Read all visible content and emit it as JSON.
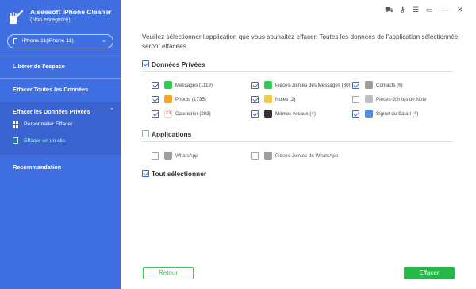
{
  "app": {
    "title": "Aiseesoft iPhone Cleaner",
    "subtitle": "(Non enregistré)"
  },
  "device": {
    "name": "iPhone 11(iPhone 11)"
  },
  "sidebar": {
    "items": [
      {
        "label": "Libérer de l'espace"
      },
      {
        "label": "Effacer Toutes les Données"
      },
      {
        "label": "Effacer les Données Privées"
      },
      {
        "label": "Recommandation"
      }
    ],
    "sub_items": [
      {
        "label": "Personnalier Effacer"
      },
      {
        "label": "Effacer en un clic"
      }
    ]
  },
  "topbar": {
    "icons": [
      "cart-icon",
      "key-icon",
      "menu-icon",
      "feedback-icon",
      "minimize-icon",
      "close-icon"
    ]
  },
  "main": {
    "intro": "Veuillez sélectionner l'application que vous souhaitez effacer. Toutes les données de l'application sélectionnée seront effacées.",
    "private_section": {
      "title": "Données Privées",
      "items": [
        {
          "label": "Messages (1119)",
          "icon": "messages-icon",
          "color": "#34c759",
          "checked": true
        },
        {
          "label": "Pièces-Jointes des Messages (30)",
          "icon": "message-attachments-icon",
          "color": "#34c759",
          "checked": true
        },
        {
          "label": "Contacts (6)",
          "icon": "contacts-icon",
          "color": "#9c9c9c",
          "checked": true
        },
        {
          "label": "Photos (1735)",
          "icon": "photos-icon",
          "color": "#f5a623",
          "checked": true
        },
        {
          "label": "Notes (2)",
          "icon": "notes-icon",
          "color": "#f7c948",
          "checked": true
        },
        {
          "label": "Pièces-Jointes de Note",
          "icon": "note-attachments-icon",
          "color": "#bdbdbd",
          "checked": false
        },
        {
          "label": "Calendrier (203)",
          "icon": "calendar-icon",
          "color": "#e94b3c",
          "checked": true,
          "glyph": "23"
        },
        {
          "label": "Mémos vocaux (4)",
          "icon": "voice-memos-icon",
          "color": "#333333",
          "checked": true
        },
        {
          "label": "Signet du Safari (4)",
          "icon": "safari-bookmarks-icon",
          "color": "#4a90e2",
          "checked": true
        }
      ]
    },
    "apps_section": {
      "title": "Applications",
      "items": [
        {
          "label": "WhatsApp",
          "icon": "whatsapp-icon",
          "color": "#9e9e9e",
          "checked": false
        },
        {
          "label": "Pièces-Jointes de WhatsApp",
          "icon": "whatsapp-attachments-icon",
          "color": "#9e9e9e",
          "checked": false
        }
      ]
    },
    "select_all": {
      "label": "Tout sélectionner",
      "checked": true
    },
    "buttons": {
      "back": "Retour",
      "erase": "Effacer"
    }
  },
  "colors": {
    "sidebar": "#3f6fe0",
    "accent": "#3b68d8",
    "green": "#27b84a"
  }
}
